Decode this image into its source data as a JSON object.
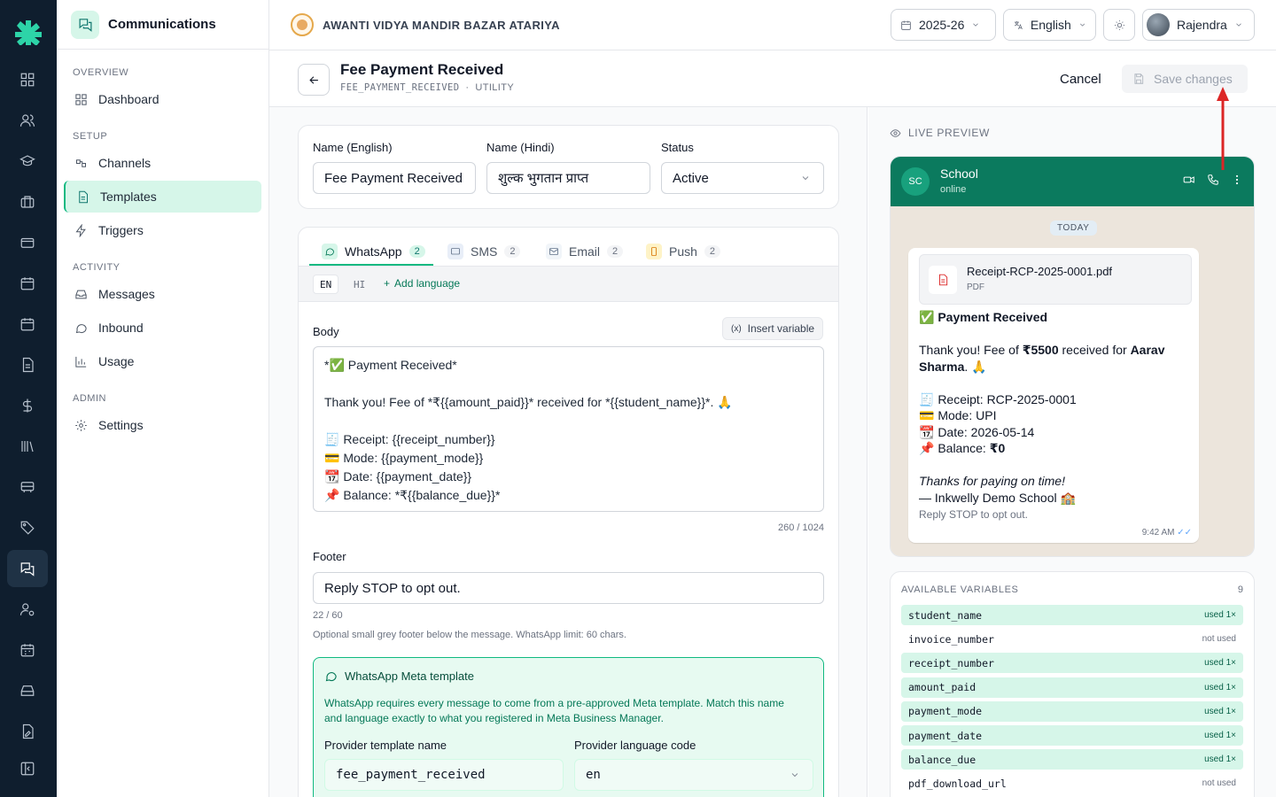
{
  "header": {
    "app_title": "Communications",
    "school_name": "AWANTI VIDYA MANDIR BAZAR ATARIYA",
    "year": "2025-26",
    "language": "English",
    "user": "Rajendra"
  },
  "sidebar": {
    "sections": [
      {
        "title": "OVERVIEW",
        "items": [
          {
            "label": "Dashboard",
            "icon": "dashboard-icon"
          }
        ]
      },
      {
        "title": "SETUP",
        "items": [
          {
            "label": "Channels",
            "icon": "channels-icon"
          },
          {
            "label": "Templates",
            "icon": "template-icon",
            "active": true
          },
          {
            "label": "Triggers",
            "icon": "bolt-icon"
          }
        ]
      },
      {
        "title": "ACTIVITY",
        "items": [
          {
            "label": "Messages",
            "icon": "inbox-icon"
          },
          {
            "label": "Inbound",
            "icon": "chat-icon"
          },
          {
            "label": "Usage",
            "icon": "bar-chart-icon"
          }
        ]
      },
      {
        "title": "ADMIN",
        "items": [
          {
            "label": "Settings",
            "icon": "gear-icon"
          }
        ]
      }
    ]
  },
  "page": {
    "title": "Fee Payment Received",
    "code": "FEE_PAYMENT_RECEIVED",
    "separator": "·",
    "category": "UTILITY",
    "cancel_label": "Cancel",
    "save_label": "Save changes"
  },
  "form": {
    "name_en_label": "Name (English)",
    "name_en_value": "Fee Payment Received",
    "name_hi_label": "Name (Hindi)",
    "name_hi_value": "शुल्क भुगतान प्राप्त",
    "status_label": "Status",
    "status_value": "Active"
  },
  "tabs": [
    {
      "label": "WhatsApp",
      "count": "2",
      "active": true
    },
    {
      "label": "SMS",
      "count": "2"
    },
    {
      "label": "Email",
      "count": "2"
    },
    {
      "label": "Push",
      "count": "2"
    }
  ],
  "languages": {
    "en": "EN",
    "hi": "HI",
    "add": "Add language"
  },
  "body": {
    "label": "Body",
    "insert_variable": "Insert variable",
    "text": "*✅ Payment Received*\n\nThank you! Fee of *₹{{amount_paid}}* received for *{{student_name}}*. 🙏\n\n🧾 Receipt: {{receipt_number}}\n💳 Mode: {{payment_mode}}\n📆 Date: {{payment_date}}\n📌 Balance: *₹{{balance_due}}*",
    "counter": "260 / 1024"
  },
  "footer": {
    "label": "Footer",
    "value": "Reply STOP to opt out.",
    "counter": "22 / 60",
    "hint": "Optional small grey footer below the message. WhatsApp limit: 60 chars."
  },
  "meta_template": {
    "title": "WhatsApp Meta template",
    "description": "WhatsApp requires every message to come from a pre-approved Meta template. Match this name and language exactly to what you registered in Meta Business Manager.",
    "name_label": "Provider template name",
    "name_value": "fee_payment_received",
    "lang_label": "Provider language code",
    "lang_value": "en"
  },
  "preview": {
    "label": "LIVE PREVIEW",
    "contact_initials": "SC",
    "contact_name": "School",
    "contact_status": "online",
    "day": "TODAY",
    "file_name": "Receipt-RCP-2025-0001.pdf",
    "file_type": "PDF",
    "title": "✅ Payment Received",
    "line_pre": "Thank you! Fee of ",
    "amount": "₹5500",
    "line_mid": " received for ",
    "student": "Aarav Sharma",
    "line_end": ". 🙏",
    "receipt": "🧾 Receipt: RCP-2025-0001",
    "mode": "💳 Mode: UPI",
    "date": "📆 Date: 2026-05-14",
    "balance_pre": "📌 Balance: ",
    "balance": "₹0",
    "thanks": "Thanks for paying on time!",
    "signature": "— Inkwelly Demo School 🏫",
    "footer": "Reply STOP to opt out.",
    "time": "9:42 AM"
  },
  "variables": {
    "label": "AVAILABLE VARIABLES",
    "count": "9",
    "items": [
      {
        "name": "student_name",
        "status": "used 1×",
        "used": true
      },
      {
        "name": "invoice_number",
        "status": "not used",
        "used": false
      },
      {
        "name": "receipt_number",
        "status": "used 1×",
        "used": true
      },
      {
        "name": "amount_paid",
        "status": "used 1×",
        "used": true
      },
      {
        "name": "payment_mode",
        "status": "used 1×",
        "used": true
      },
      {
        "name": "payment_date",
        "status": "used 1×",
        "used": true
      },
      {
        "name": "balance_due",
        "status": "used 1×",
        "used": true
      },
      {
        "name": "pdf_download_url",
        "status": "not used",
        "used": false
      }
    ]
  },
  "colors": {
    "accent": "#10b981",
    "whatsapp_header": "#0b7a5e",
    "rail": "#0f1e2e",
    "annotation_arrow": "#dc2626"
  }
}
